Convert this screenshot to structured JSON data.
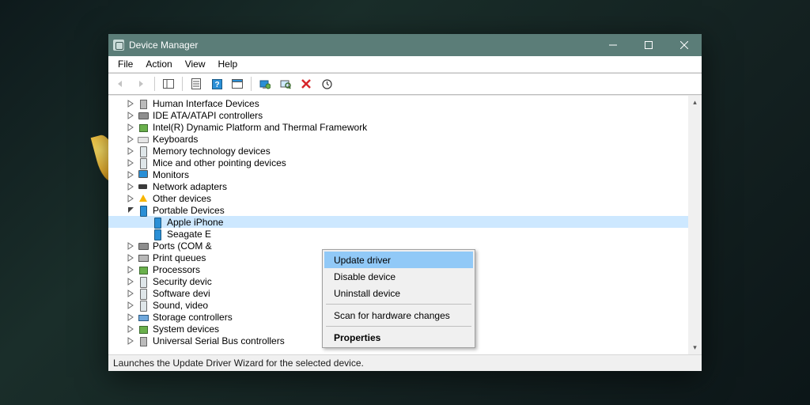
{
  "window": {
    "title": "Device Manager"
  },
  "menu": {
    "file": "File",
    "action": "Action",
    "view": "View",
    "help": "Help"
  },
  "tree": {
    "items": [
      {
        "label": "Human Interface Devices",
        "icon": "di-usb"
      },
      {
        "label": "IDE ATA/ATAPI controllers",
        "icon": "di-port"
      },
      {
        "label": "Intel(R) Dynamic Platform and Thermal Framework",
        "icon": "di-chip"
      },
      {
        "label": "Keyboards",
        "icon": "di-kbd"
      },
      {
        "label": "Memory technology devices",
        "icon": "di-dev"
      },
      {
        "label": "Mice and other pointing devices",
        "icon": "di-dev"
      },
      {
        "label": "Monitors",
        "icon": "di-mon"
      },
      {
        "label": "Network adapters",
        "icon": "di-net"
      },
      {
        "label": "Other devices",
        "icon": "di-warn"
      },
      {
        "label": "Portable Devices",
        "icon": "di-phone",
        "expanded": true,
        "children": [
          {
            "label": "Apple iPhone",
            "icon": "di-phone",
            "selected": true
          },
          {
            "label": "Seagate E",
            "icon": "di-phone"
          }
        ]
      },
      {
        "label": "Ports (COM &",
        "icon": "di-port"
      },
      {
        "label": "Print queues",
        "icon": "di-print"
      },
      {
        "label": "Processors",
        "icon": "di-chip"
      },
      {
        "label": "Security devic",
        "icon": "di-dev"
      },
      {
        "label": "Software devi",
        "icon": "di-dev"
      },
      {
        "label": "Sound, video",
        "icon": "di-dev"
      },
      {
        "label": "Storage controllers",
        "icon": "di-stor"
      },
      {
        "label": "System devices",
        "icon": "di-chip"
      },
      {
        "label": "Universal Serial Bus controllers",
        "icon": "di-usb"
      }
    ]
  },
  "context_menu": {
    "update": "Update driver",
    "disable": "Disable device",
    "uninstall": "Uninstall device",
    "scan": "Scan for hardware changes",
    "properties": "Properties"
  },
  "status": {
    "text": "Launches the Update Driver Wizard for the selected device."
  }
}
